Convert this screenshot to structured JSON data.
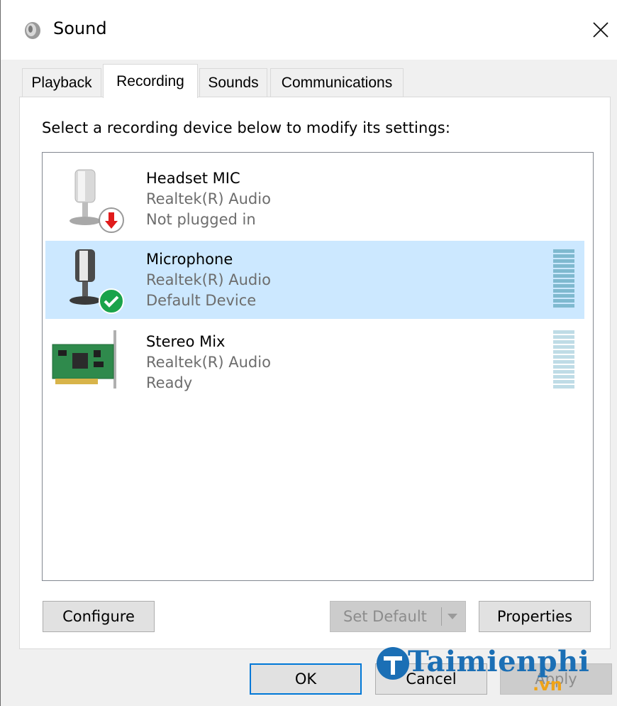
{
  "window": {
    "title": "Sound",
    "close_icon": "close-icon"
  },
  "tabs": [
    {
      "label": "Playback",
      "active": false
    },
    {
      "label": "Recording",
      "active": true
    },
    {
      "label": "Sounds",
      "active": false
    },
    {
      "label": "Communications",
      "active": false
    }
  ],
  "panel": {
    "instruction": "Select a recording device below to modify its settings:"
  },
  "devices": [
    {
      "name": "Headset MIC",
      "driver": "Realtek(R) Audio",
      "status": "Not plugged in",
      "icon": "microphone-icon",
      "badge": "unplugged-icon",
      "selected": false
    },
    {
      "name": "Microphone",
      "driver": "Realtek(R) Audio",
      "status": "Default Device",
      "icon": "microphone-icon",
      "badge": "default-check-icon",
      "selected": true
    },
    {
      "name": "Stereo Mix",
      "driver": "Realtek(R) Audio",
      "status": "Ready",
      "icon": "sound-card-icon",
      "badge": "",
      "selected": false
    }
  ],
  "buttons": {
    "configure": "Configure",
    "set_default": "Set Default",
    "properties": "Properties",
    "ok": "OK",
    "cancel": "Cancel",
    "apply": "Apply"
  },
  "watermark": {
    "main": "Taimienphi",
    "suffix": ".vn"
  },
  "colors": {
    "selection": "#cce8ff",
    "accent": "#0078d7",
    "secondary_text": "#6d6d6d",
    "check_green": "#1aa34a",
    "unplugged_red": "#e01b1b",
    "watermark_blue": "#1b6fb5",
    "watermark_orange": "#f0a317"
  }
}
